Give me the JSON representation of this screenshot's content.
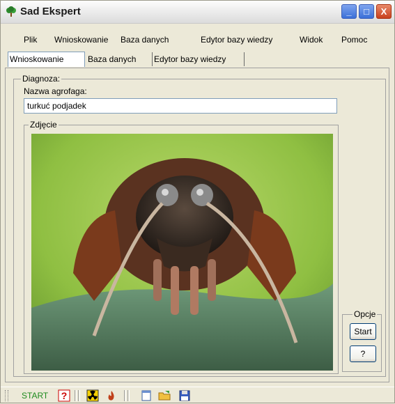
{
  "window": {
    "title": "Sad Ekspert",
    "minimize": "_",
    "maximize": "□",
    "close": "X"
  },
  "menu": [
    "Plik",
    "Wnioskowanie",
    "Baza danych",
    "Edytor bazy wiedzy",
    "Widok",
    "Pomoc"
  ],
  "tabs": [
    "Wnioskowanie",
    "Baza danych",
    "Edytor bazy wiedzy"
  ],
  "diagnosis": {
    "group_label": "Diagnoza:",
    "name_label": "Nazwa agrofaga:",
    "name_value": "turkuć podjadek",
    "photo_label": "Zdjęcie"
  },
  "options": {
    "group_label": "Opcje",
    "start_label": "Start",
    "help_label": "?"
  },
  "statusbar": {
    "text": "START",
    "help_icon": "?"
  },
  "icons": [
    "tree-app-icon",
    "help-icon",
    "radiation-icon",
    "fire-icon",
    "new-document-icon",
    "open-folder-icon",
    "save-disk-icon"
  ],
  "colors": {
    "accent": "#3a6fd8",
    "close": "#c8401d",
    "status_text": "#1e8a1e"
  }
}
